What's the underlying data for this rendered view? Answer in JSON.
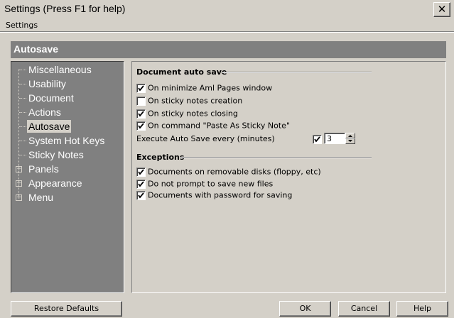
{
  "window": {
    "title": "Settings (Press F1 for help)",
    "close_glyph": "✕"
  },
  "menubar": {
    "label": "Settings"
  },
  "section": {
    "title": "Autosave"
  },
  "tree": {
    "items": [
      {
        "label": "Miscellaneous",
        "expandable": false,
        "selected": false
      },
      {
        "label": "Usability",
        "expandable": false,
        "selected": false
      },
      {
        "label": "Document",
        "expandable": false,
        "selected": false
      },
      {
        "label": "Actions",
        "expandable": false,
        "selected": false
      },
      {
        "label": "Autosave",
        "expandable": false,
        "selected": true
      },
      {
        "label": "System Hot Keys",
        "expandable": false,
        "selected": false
      },
      {
        "label": "Sticky Notes",
        "expandable": false,
        "selected": false
      },
      {
        "label": "Panels",
        "expandable": true,
        "selected": false
      },
      {
        "label": "Appearance",
        "expandable": true,
        "selected": false
      },
      {
        "label": "Menu",
        "expandable": true,
        "selected": false
      }
    ]
  },
  "document_auto_save": {
    "title": "Document auto save",
    "options": [
      {
        "label": "On minimize Aml Pages window",
        "checked": true
      },
      {
        "label": "On sticky notes creation",
        "checked": false
      },
      {
        "label": "On sticky notes closing",
        "checked": true
      },
      {
        "label": "On command \"Paste As Sticky Note\"",
        "checked": true
      }
    ],
    "interval": {
      "label": "Execute Auto Save every (minutes)",
      "checked": true,
      "value": "3"
    }
  },
  "exceptions": {
    "title": "Exceptions",
    "options": [
      {
        "label": "Documents on removable disks (floppy, etc)",
        "checked": true
      },
      {
        "label": "Do not prompt to save new files",
        "checked": true
      },
      {
        "label": "Documents with password for saving",
        "checked": true
      }
    ]
  },
  "buttons": {
    "restore_defaults": "Restore Defaults",
    "ok": "OK",
    "cancel": "Cancel",
    "help": "Help"
  }
}
